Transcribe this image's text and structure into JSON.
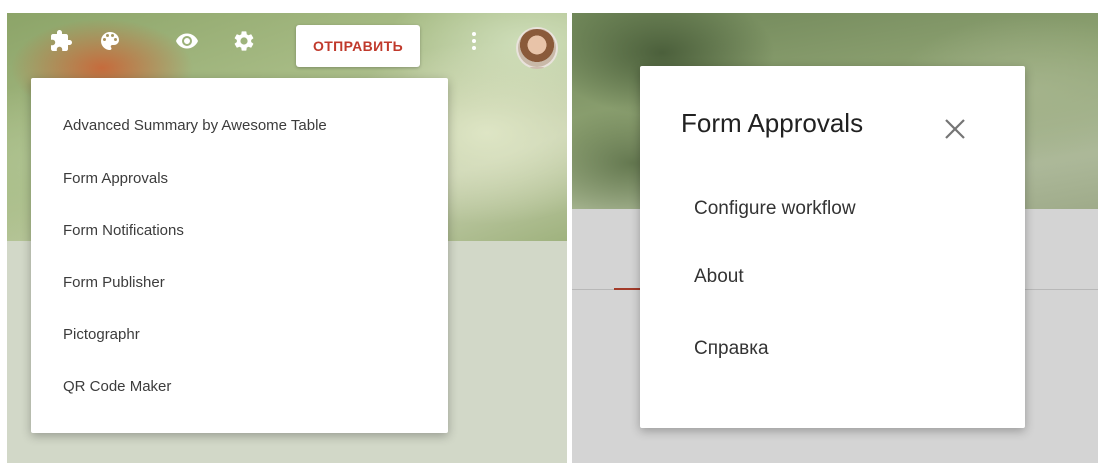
{
  "toolbar": {
    "icons": [
      "puzzle-icon",
      "palette-icon",
      "eye-icon",
      "gear-icon",
      "more-vert-icon"
    ],
    "send_label": "ОТПРАВИТЬ"
  },
  "addons_menu": {
    "items": [
      {
        "label": "Advanced Summary by Awesome Table"
      },
      {
        "label": "Form Approvals"
      },
      {
        "label": "Form Notifications"
      },
      {
        "label": "Form Publisher"
      },
      {
        "label": "Pictographr"
      },
      {
        "label": "QR Code Maker"
      }
    ]
  },
  "dialog": {
    "title": "Form Approvals",
    "close_icon": "close-icon",
    "items": [
      {
        "label": "Configure workflow"
      },
      {
        "label": "About"
      },
      {
        "label": "Справка"
      }
    ]
  },
  "colors": {
    "accent": "#c0392b",
    "menu_text": "#3c3c3c",
    "dialog_title": "#212121"
  }
}
